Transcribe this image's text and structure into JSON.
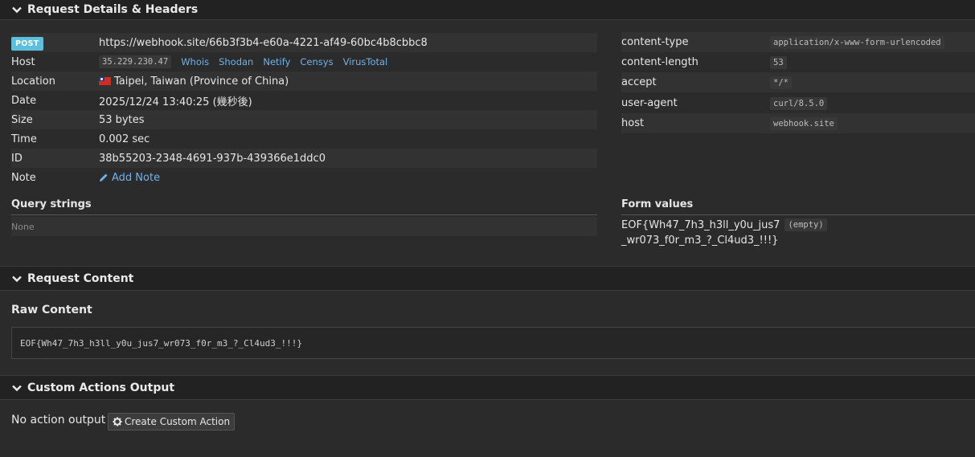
{
  "sections": {
    "details": "Request Details & Headers",
    "content": "Request Content",
    "actions": "Custom Actions Output"
  },
  "request": {
    "method": "POST",
    "url": "https://webhook.site/66b3f3b4-e60a-4221-af49-60bc4b8cbbc8",
    "labels": {
      "host": "Host",
      "location": "Location",
      "date": "Date",
      "size": "Size",
      "time": "Time",
      "id": "ID",
      "note": "Note"
    },
    "host_ip": "35.229.230.47",
    "host_links": [
      "Whois",
      "Shodan",
      "Netify",
      "Censys",
      "VirusTotal"
    ],
    "location": "Taipei, Taiwan (Province of China)",
    "date": "2025/12/24 13:40:25 (幾秒後)",
    "size": "53 bytes",
    "time": "0.002 sec",
    "id": "38b55203-2348-4691-937b-439366e1ddc0",
    "add_note": "Add Note"
  },
  "headers": [
    {
      "key": "content-type",
      "value": "application/x-www-form-urlencoded"
    },
    {
      "key": "content-length",
      "value": "53"
    },
    {
      "key": "accept",
      "value": "*/*"
    },
    {
      "key": "user-agent",
      "value": "curl/8.5.0"
    },
    {
      "key": "host",
      "value": "webhook.site"
    }
  ],
  "query": {
    "title": "Query strings",
    "value": "None"
  },
  "form": {
    "title": "Form values",
    "key_line1": "EOF{Wh47_7h3_h3ll_y0u_jus7",
    "key_line2": "_wr073_f0r_m3_?_Cl4ud3_!!!}",
    "value": "(empty)"
  },
  "raw": {
    "title": "Raw Content",
    "body": "EOF{Wh47_7h3_h3ll_y0u_jus7_wr073_f0r_m3_?_Cl4ud3_!!!}"
  },
  "actions": {
    "empty_text": "No action output",
    "create_button": "Create Custom Action"
  },
  "colors": {
    "link": "#6fb3ea",
    "post_badge": "#5bc0de",
    "header_bg": "#222222",
    "panel_bg": "#2b2b2b"
  }
}
